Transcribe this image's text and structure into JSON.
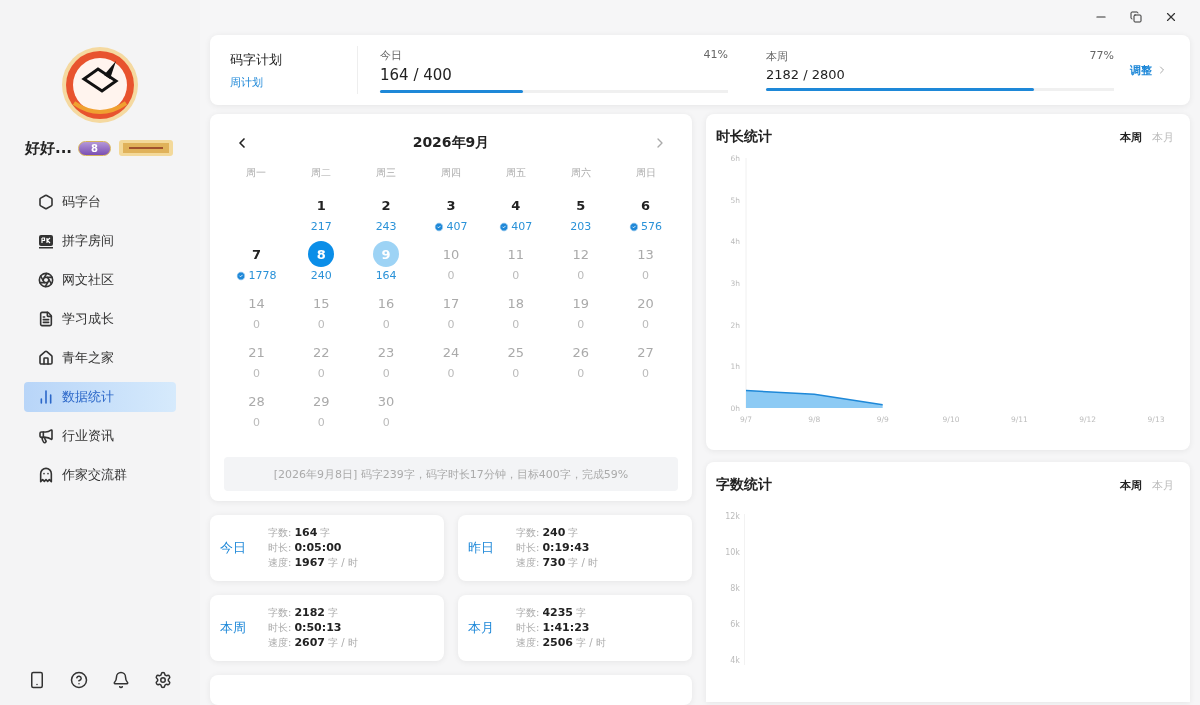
{
  "user": {
    "name": "好好...",
    "level_badge": "8"
  },
  "nav": [
    {
      "label": "码字台",
      "selected": false
    },
    {
      "label": "拼字房间",
      "selected": false
    },
    {
      "label": "网文社区",
      "selected": false
    },
    {
      "label": "学习成长",
      "selected": false
    },
    {
      "label": "青年之家",
      "selected": false
    },
    {
      "label": "数据统计",
      "selected": true
    },
    {
      "label": "行业资讯",
      "selected": false
    },
    {
      "label": "作家交流群",
      "selected": false
    }
  ],
  "plan": {
    "title": "码字计划",
    "subtitle": "周计划",
    "adjust": "调整",
    "goals": [
      {
        "label": "今日",
        "value": "164 / 400",
        "percent": "41%",
        "level": 0.41
      },
      {
        "label": "本周",
        "value": "2182 / 2800",
        "percent": "77%",
        "level": 0.77
      }
    ]
  },
  "calendar": {
    "title": "2026年9月",
    "weekdays": [
      "周一",
      "周二",
      "周三",
      "周四",
      "周五",
      "周六",
      "周日"
    ],
    "weeks": [
      [
        {
          "kind": "empty"
        },
        {
          "day": "1",
          "count": "217",
          "kind": "past",
          "goal_met": false,
          "selected": false,
          "current": false
        },
        {
          "day": "2",
          "count": "243",
          "kind": "past",
          "goal_met": false,
          "selected": false,
          "current": false
        },
        {
          "day": "3",
          "count": "407",
          "kind": "past",
          "goal_met": true,
          "selected": false,
          "current": false
        },
        {
          "day": "4",
          "count": "407",
          "kind": "past",
          "goal_met": true,
          "selected": false,
          "current": false
        },
        {
          "day": "5",
          "count": "203",
          "kind": "past",
          "goal_met": false,
          "selected": false,
          "current": false
        },
        {
          "day": "6",
          "count": "576",
          "kind": "past",
          "goal_met": true,
          "selected": false,
          "current": false
        }
      ],
      [
        {
          "day": "7",
          "count": "1778",
          "kind": "past",
          "goal_met": true,
          "selected": false,
          "current": false
        },
        {
          "day": "8",
          "count": "240",
          "kind": "past",
          "goal_met": false,
          "selected": true,
          "current": false
        },
        {
          "day": "9",
          "count": "164",
          "kind": "past",
          "goal_met": false,
          "selected": false,
          "current": true
        },
        {
          "day": "10",
          "count": "0",
          "kind": "future",
          "goal_met": false,
          "selected": false,
          "current": false
        },
        {
          "day": "11",
          "count": "0",
          "kind": "future",
          "goal_met": false,
          "selected": false,
          "current": false
        },
        {
          "day": "12",
          "count": "0",
          "kind": "future",
          "goal_met": false,
          "selected": false,
          "current": false
        },
        {
          "day": "13",
          "count": "0",
          "kind": "future",
          "goal_met": false,
          "selected": false,
          "current": false
        }
      ],
      [
        {
          "day": "14",
          "count": "0",
          "kind": "future",
          "goal_met": false,
          "selected": false,
          "current": false
        },
        {
          "day": "15",
          "count": "0",
          "kind": "future",
          "goal_met": false,
          "selected": false,
          "current": false
        },
        {
          "day": "16",
          "count": "0",
          "kind": "future",
          "goal_met": false,
          "selected": false,
          "current": false
        },
        {
          "day": "17",
          "count": "0",
          "kind": "future",
          "goal_met": false,
          "selected": false,
          "current": false
        },
        {
          "day": "18",
          "count": "0",
          "kind": "future",
          "goal_met": false,
          "selected": false,
          "current": false
        },
        {
          "day": "19",
          "count": "0",
          "kind": "future",
          "goal_met": false,
          "selected": false,
          "current": false
        },
        {
          "day": "20",
          "count": "0",
          "kind": "future",
          "goal_met": false,
          "selected": false,
          "current": false
        }
      ],
      [
        {
          "day": "21",
          "count": "0",
          "kind": "future",
          "goal_met": false,
          "selected": false,
          "current": false
        },
        {
          "day": "22",
          "count": "0",
          "kind": "future",
          "goal_met": false,
          "selected": false,
          "current": false
        },
        {
          "day": "23",
          "count": "0",
          "kind": "future",
          "goal_met": false,
          "selected": false,
          "current": false
        },
        {
          "day": "24",
          "count": "0",
          "kind": "future",
          "goal_met": false,
          "selected": false,
          "current": false
        },
        {
          "day": "25",
          "count": "0",
          "kind": "future",
          "goal_met": false,
          "selected": false,
          "current": false
        },
        {
          "day": "26",
          "count": "0",
          "kind": "future",
          "goal_met": false,
          "selected": false,
          "current": false
        },
        {
          "day": "27",
          "count": "0",
          "kind": "future",
          "goal_met": false,
          "selected": false,
          "current": false
        }
      ],
      [
        {
          "day": "28",
          "count": "0",
          "kind": "future",
          "goal_met": false,
          "selected": false,
          "current": false
        },
        {
          "day": "29",
          "count": "0",
          "kind": "future",
          "goal_met": false,
          "selected": false,
          "current": false
        },
        {
          "day": "30",
          "count": "0",
          "kind": "future",
          "goal_met": false,
          "selected": false,
          "current": false
        }
      ]
    ],
    "summary": "[2026年9月8日] 码字239字，码字时长17分钟，目标400字，完成59%"
  },
  "stats": [
    {
      "period": "今日",
      "rows": [
        {
          "label": "字数:",
          "value": "164",
          "unit": "字"
        },
        {
          "label": "时长:",
          "value": "0:05:00"
        },
        {
          "label": "速度:",
          "value": "1967",
          "unit": "字 / 时"
        }
      ]
    },
    {
      "period": "昨日",
      "rows": [
        {
          "label": "字数:",
          "value": "240",
          "unit": "字"
        },
        {
          "label": "时长:",
          "value": "0:19:43"
        },
        {
          "label": "速度:",
          "value": "730",
          "unit": "字 / 时"
        }
      ]
    },
    {
      "period": "本周",
      "rows": [
        {
          "label": "字数:",
          "value": "2182",
          "unit": "字"
        },
        {
          "label": "时长:",
          "value": "0:50:13"
        },
        {
          "label": "速度:",
          "value": "2607",
          "unit": "字 / 时"
        }
      ]
    },
    {
      "period": "本月",
      "rows": [
        {
          "label": "字数:",
          "value": "4235",
          "unit": "字"
        },
        {
          "label": "时长:",
          "value": "1:41:23"
        },
        {
          "label": "速度:",
          "value": "2506",
          "unit": "字 / 时"
        }
      ]
    }
  ],
  "duration": {
    "title": "时长统计",
    "tabs": [
      {
        "label": "本周",
        "selected": true
      },
      {
        "label": "本月",
        "selected": false
      }
    ],
    "chart_data": {
      "type": "area",
      "categories": [
        "9/7",
        "9/8",
        "9/9",
        "9/10",
        "9/11",
        "9/12",
        "9/13"
      ],
      "series": [
        {
          "color": "#1e88d8",
          "values": [
            0.42,
            0.33,
            0.08,
            null,
            null,
            null,
            null
          ]
        }
      ],
      "ylim": [
        0,
        6
      ],
      "yticks": [
        {
          "value": 0,
          "label": "0h"
        },
        {
          "value": 1,
          "label": "1h"
        },
        {
          "value": 2,
          "label": "2h"
        },
        {
          "value": 3,
          "label": "3h"
        },
        {
          "value": 4,
          "label": "4h"
        },
        {
          "value": 5,
          "label": "5h"
        },
        {
          "value": 6,
          "label": "6h"
        }
      ]
    }
  },
  "words": {
    "title": "字数统计",
    "tabs": [
      {
        "label": "本周",
        "selected": true
      },
      {
        "label": "本月",
        "selected": false
      }
    ],
    "y_axis_labels": [
      "12k",
      "10k",
      "8k",
      "6k",
      "4k"
    ]
  }
}
